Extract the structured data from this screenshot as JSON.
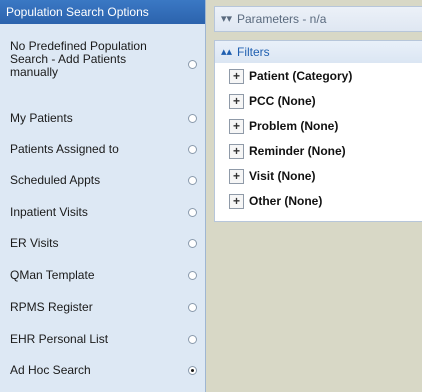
{
  "sidebar": {
    "title": "Population Search Options",
    "options": [
      {
        "label_lines": [
          "No Predefined Population",
          "Search - Add Patients",
          "manually"
        ],
        "checked": false
      },
      {
        "label_lines": [
          "My Patients"
        ],
        "checked": false
      },
      {
        "label_lines": [
          "Patients Assigned to"
        ],
        "checked": false
      },
      {
        "label_lines": [
          "Scheduled Appts"
        ],
        "checked": false
      },
      {
        "label_lines": [
          "Inpatient Visits"
        ],
        "checked": false
      },
      {
        "label_lines": [
          "ER Visits"
        ],
        "checked": false
      },
      {
        "label_lines": [
          "QMan Template"
        ],
        "checked": false
      },
      {
        "label_lines": [
          "RPMS Register"
        ],
        "checked": false
      },
      {
        "label_lines": [
          "EHR Personal List"
        ],
        "checked": false
      },
      {
        "label_lines": [
          "Ad Hoc Search"
        ],
        "checked": true
      }
    ]
  },
  "parameters": {
    "icon": "double-chevron-down-icon",
    "label": "Parameters - n/a"
  },
  "filters": {
    "icon": "double-chevron-up-icon",
    "label": "Filters",
    "expand_symbol": "+",
    "rows": [
      "Patient (Category)",
      "PCC (None)",
      "Problem (None)",
      "Reminder (None)",
      "Visit (None)",
      "Other (None)"
    ]
  },
  "colors": {
    "header_blue": "#2c63ad",
    "sidebar_bg": "#dde8f4",
    "right_bg": "#d8d8c6",
    "filter_head_text": "#1f5fb0"
  }
}
